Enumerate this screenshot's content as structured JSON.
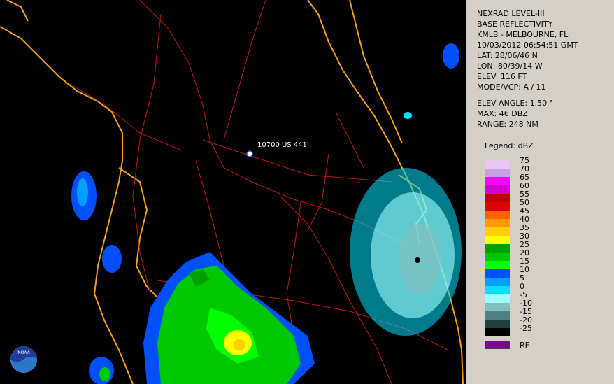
{
  "info": {
    "product": "NEXRAD LEVEL-III",
    "type": "BASE REFLECTIVITY",
    "station": "KMLB - MELBOURNE, FL",
    "datetime": "10/03/2012 06:54:51 GMT",
    "lat": "LAT: 28/06/46 N",
    "lon": "LON: 80/39/14 W",
    "elev": "ELEV: 116 FT",
    "mode": "MODE/VCP: A / 11",
    "elev_angle": "ELEV ANGLE: 1.50 °",
    "max": "MAX: 46 DBZ",
    "range": "RANGE: 248 NM"
  },
  "legend": {
    "title": "Legend: dBZ",
    "labels": [
      "75",
      "70",
      "65",
      "60",
      "55",
      "50",
      "45",
      "40",
      "35",
      "30",
      "25",
      "20",
      "15",
      "10",
      "5",
      "0",
      "-5",
      "-10",
      "-15",
      "-20",
      "-25"
    ],
    "colors": [
      "#e8c8f0",
      "#c8a0e0",
      "#ff00ff",
      "#d000d0",
      "#c00000",
      "#e00000",
      "#ff6000",
      "#ff9900",
      "#ffd000",
      "#ffff00",
      "#00a000",
      "#00c800",
      "#00ff00",
      "#0050ff",
      "#00a0ff",
      "#00e0ff",
      "#a0ffff",
      "#80c0c0",
      "#508080",
      "#204040",
      "#000000"
    ],
    "rf_label": "RF",
    "rf_color": "#7a0a8c"
  },
  "map": {
    "marker_label": "10700 US 441'",
    "coast_color": "#f0a020",
    "road_color": "#c01818",
    "logo_text": "NOAA"
  }
}
